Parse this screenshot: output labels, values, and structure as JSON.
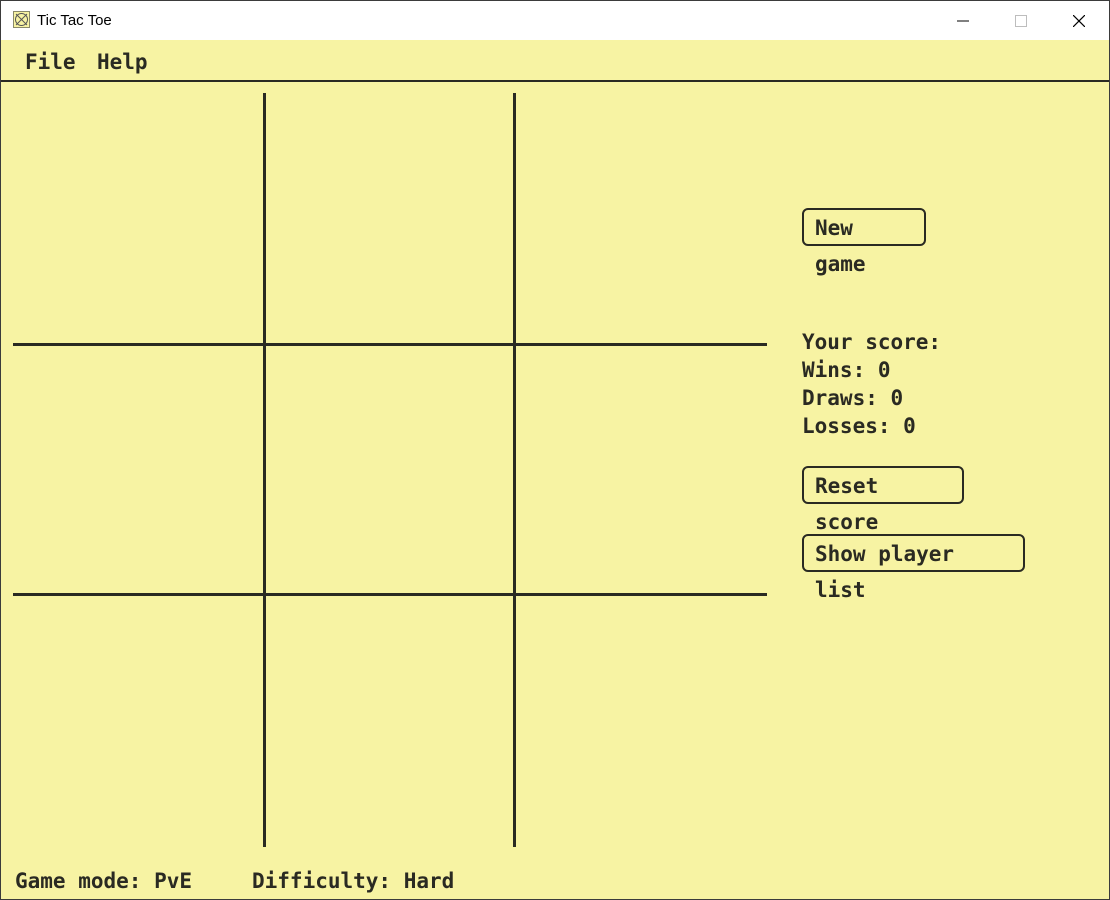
{
  "window": {
    "title": "Tic Tac Toe",
    "icon": "tic-tac-toe-app-icon"
  },
  "menu": {
    "items": [
      "File",
      "Help"
    ]
  },
  "board": {
    "rows": 3,
    "cols": 3,
    "cells": [
      "",
      "",
      "",
      "",
      "",
      "",
      "",
      "",
      ""
    ]
  },
  "buttons": {
    "new_game": "New game",
    "reset_score": "Reset score",
    "show_players": "Show player list"
  },
  "score": {
    "title": "Your score:",
    "wins": "Wins: 0",
    "draws": "Draws: 0",
    "losses": "Losses: 0"
  },
  "status": {
    "mode": "Game mode: PvE",
    "difficulty": "Difficulty: Hard"
  },
  "colors": {
    "background": "#f7f3a3",
    "ink": "#2a2a22"
  }
}
